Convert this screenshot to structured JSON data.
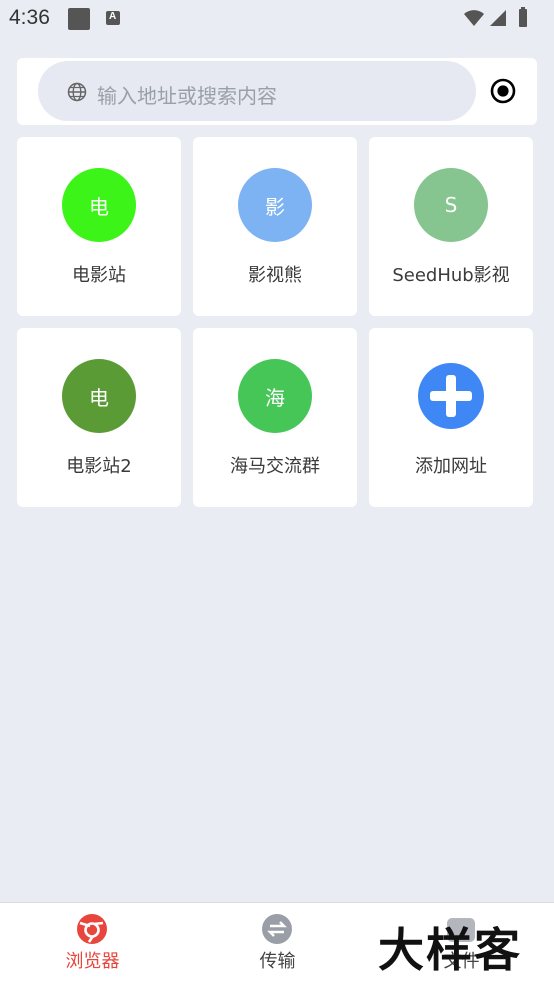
{
  "status_bar": {
    "time": "4:36"
  },
  "search": {
    "placeholder": "输入地址或搜索内容"
  },
  "tiles": [
    {
      "glyph": "电",
      "label": "电影站",
      "color": "#3cf417"
    },
    {
      "glyph": "影",
      "label": "影视熊",
      "color": "#7db3f2"
    },
    {
      "glyph": "S",
      "label": "SeedHub影视",
      "color": "#86c58f"
    },
    {
      "glyph": "电",
      "label": "电影站2",
      "color": "#5b9b36"
    },
    {
      "glyph": "海",
      "label": "海马交流群",
      "color": "#47c658"
    },
    {
      "glyph": "+",
      "label": "添加网址",
      "color": "#3f87f5"
    }
  ],
  "nav": {
    "items": [
      {
        "label": "浏览器",
        "icon": "browser-icon",
        "active": true
      },
      {
        "label": "传输",
        "icon": "transfer-icon",
        "active": false
      },
      {
        "label": "文件",
        "icon": "file-icon",
        "active": false
      }
    ],
    "active_color": "#e8453c"
  },
  "watermark": "大样客"
}
